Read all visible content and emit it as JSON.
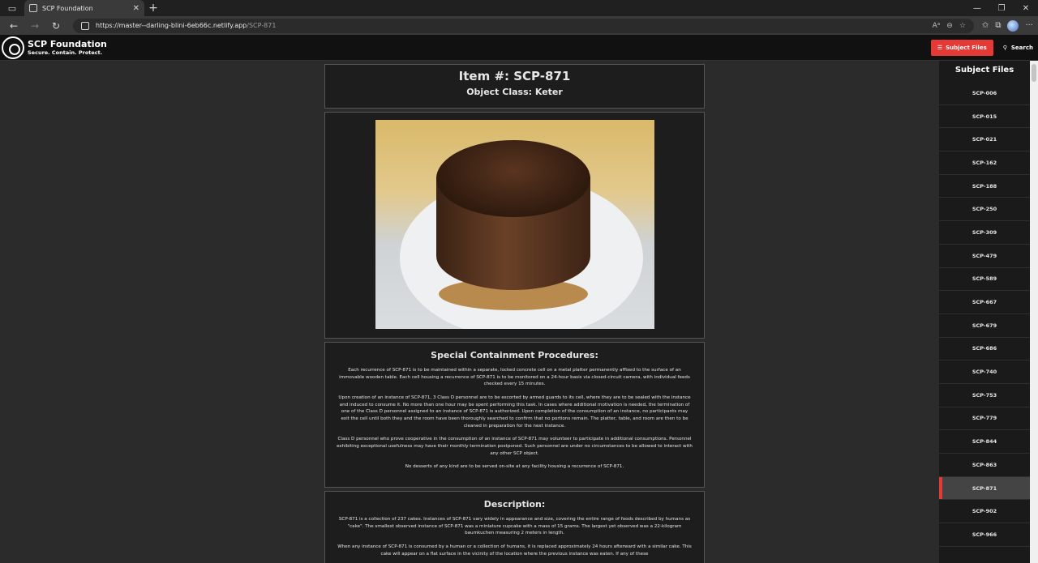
{
  "browser": {
    "tab_title": "SCP Foundation",
    "url_host": "https://master--darling-blini-6eb66c.netlify.app",
    "url_path": "/SCP-871"
  },
  "site": {
    "name": "SCP Foundation",
    "tagline": "Secure. Contain. Protect.",
    "subject_files_button": "Subject Files",
    "search_button": "Search"
  },
  "item": {
    "number": "Item #: SCP-871",
    "object_class": "Object Class: Keter"
  },
  "containment": {
    "heading": "Special Containment Procedures:",
    "paragraphs": [
      "Each recurrence of SCP-871 is to be maintained within a separate, locked concrete cell on a metal platter permanently affixed to the surface of an immovable wooden table. Each cell housing a recurrence of SCP-871 is to be monitored on a 24-hour basis via closed-circuit camera, with individual feeds checked every 15 minutes.",
      "Upon creation of an instance of SCP-871, 3 Class D personnel are to be escorted by armed guards to its cell, where they are to be sealed with the instance and induced to consume it. No more than one hour may be spent performing this task. In cases where additional motivation is needed, the termination of one of the Class D personnel assigned to an instance of SCP-871 is authorized. Upon completion of the consumption of an instance, no participants may exit the cell until both they and the room have been thoroughly searched to confirm that no portions remain. The platter, table, and room are then to be cleaned in preparation for the next instance.",
      "Class D personnel who prove cooperative in the consumption of an instance of SCP-871 may volunteer to participate in additional consumptions. Personnel exhibiting exceptional usefulness may have their monthly termination postponed. Such personnel are under no circumstances to be allowed to interact with any other SCP object.",
      "No desserts of any kind are to be served on-site at any facility housing a recurrence of SCP-871."
    ]
  },
  "description": {
    "heading": "Description:",
    "paragraphs": [
      "SCP-871 is a collection of 237 cakes. Instances of SCP-871 vary widely in appearance and size, covering the entire range of foods described by humans as \"cake\". The smallest observed instance of SCP-871 was a miniature cupcake with a mass of 15 grams. The largest yet observed was a 22-kilogram baumkuchen measuring 2 meters in length.",
      "When any instance of SCP-871 is consumed by a human or a collection of humans, it is replaced approximately 24 hours afterward with a similar cake. This cake will appear on a flat surface in the vicinity of the location where the previous instance was eaten. If any of these"
    ]
  },
  "sidebar": {
    "title": "Subject Files",
    "items": [
      "SCP-006",
      "SCP-015",
      "SCP-021",
      "SCP-162",
      "SCP-188",
      "SCP-250",
      "SCP-309",
      "SCP-479",
      "SCP-589",
      "SCP-667",
      "SCP-679",
      "SCP-686",
      "SCP-740",
      "SCP-753",
      "SCP-779",
      "SCP-844",
      "SCP-863",
      "SCP-871",
      "SCP-902",
      "SCP-966"
    ],
    "active": "SCP-871"
  },
  "colors": {
    "accent": "#e53935",
    "panel": "#1d1d1d",
    "background": "#2b2b2b"
  }
}
